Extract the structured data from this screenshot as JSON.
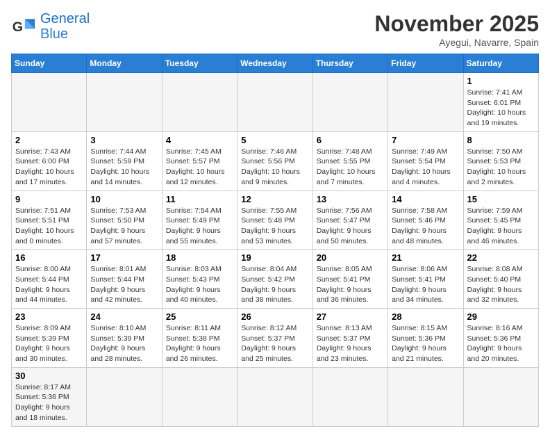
{
  "header": {
    "logo_general": "General",
    "logo_blue": "Blue",
    "month_title": "November 2025",
    "location": "Ayegui, Navarre, Spain"
  },
  "weekdays": [
    "Sunday",
    "Monday",
    "Tuesday",
    "Wednesday",
    "Thursday",
    "Friday",
    "Saturday"
  ],
  "weeks": [
    [
      {
        "day": "",
        "info": ""
      },
      {
        "day": "",
        "info": ""
      },
      {
        "day": "",
        "info": ""
      },
      {
        "day": "",
        "info": ""
      },
      {
        "day": "",
        "info": ""
      },
      {
        "day": "",
        "info": ""
      },
      {
        "day": "1",
        "info": "Sunrise: 7:41 AM\nSunset: 6:01 PM\nDaylight: 10 hours and 19 minutes."
      }
    ],
    [
      {
        "day": "2",
        "info": "Sunrise: 7:43 AM\nSunset: 6:00 PM\nDaylight: 10 hours and 17 minutes."
      },
      {
        "day": "3",
        "info": "Sunrise: 7:44 AM\nSunset: 5:59 PM\nDaylight: 10 hours and 14 minutes."
      },
      {
        "day": "4",
        "info": "Sunrise: 7:45 AM\nSunset: 5:57 PM\nDaylight: 10 hours and 12 minutes."
      },
      {
        "day": "5",
        "info": "Sunrise: 7:46 AM\nSunset: 5:56 PM\nDaylight: 10 hours and 9 minutes."
      },
      {
        "day": "6",
        "info": "Sunrise: 7:48 AM\nSunset: 5:55 PM\nDaylight: 10 hours and 7 minutes."
      },
      {
        "day": "7",
        "info": "Sunrise: 7:49 AM\nSunset: 5:54 PM\nDaylight: 10 hours and 4 minutes."
      },
      {
        "day": "8",
        "info": "Sunrise: 7:50 AM\nSunset: 5:53 PM\nDaylight: 10 hours and 2 minutes."
      }
    ],
    [
      {
        "day": "9",
        "info": "Sunrise: 7:51 AM\nSunset: 5:51 PM\nDaylight: 10 hours and 0 minutes."
      },
      {
        "day": "10",
        "info": "Sunrise: 7:53 AM\nSunset: 5:50 PM\nDaylight: 9 hours and 57 minutes."
      },
      {
        "day": "11",
        "info": "Sunrise: 7:54 AM\nSunset: 5:49 PM\nDaylight: 9 hours and 55 minutes."
      },
      {
        "day": "12",
        "info": "Sunrise: 7:55 AM\nSunset: 5:48 PM\nDaylight: 9 hours and 53 minutes."
      },
      {
        "day": "13",
        "info": "Sunrise: 7:56 AM\nSunset: 5:47 PM\nDaylight: 9 hours and 50 minutes."
      },
      {
        "day": "14",
        "info": "Sunrise: 7:58 AM\nSunset: 5:46 PM\nDaylight: 9 hours and 48 minutes."
      },
      {
        "day": "15",
        "info": "Sunrise: 7:59 AM\nSunset: 5:45 PM\nDaylight: 9 hours and 46 minutes."
      }
    ],
    [
      {
        "day": "16",
        "info": "Sunrise: 8:00 AM\nSunset: 5:44 PM\nDaylight: 9 hours and 44 minutes."
      },
      {
        "day": "17",
        "info": "Sunrise: 8:01 AM\nSunset: 5:44 PM\nDaylight: 9 hours and 42 minutes."
      },
      {
        "day": "18",
        "info": "Sunrise: 8:03 AM\nSunset: 5:43 PM\nDaylight: 9 hours and 40 minutes."
      },
      {
        "day": "19",
        "info": "Sunrise: 8:04 AM\nSunset: 5:42 PM\nDaylight: 9 hours and 38 minutes."
      },
      {
        "day": "20",
        "info": "Sunrise: 8:05 AM\nSunset: 5:41 PM\nDaylight: 9 hours and 36 minutes."
      },
      {
        "day": "21",
        "info": "Sunrise: 8:06 AM\nSunset: 5:41 PM\nDaylight: 9 hours and 34 minutes."
      },
      {
        "day": "22",
        "info": "Sunrise: 8:08 AM\nSunset: 5:40 PM\nDaylight: 9 hours and 32 minutes."
      }
    ],
    [
      {
        "day": "23",
        "info": "Sunrise: 8:09 AM\nSunset: 5:39 PM\nDaylight: 9 hours and 30 minutes."
      },
      {
        "day": "24",
        "info": "Sunrise: 8:10 AM\nSunset: 5:39 PM\nDaylight: 9 hours and 28 minutes."
      },
      {
        "day": "25",
        "info": "Sunrise: 8:11 AM\nSunset: 5:38 PM\nDaylight: 9 hours and 26 minutes."
      },
      {
        "day": "26",
        "info": "Sunrise: 8:12 AM\nSunset: 5:37 PM\nDaylight: 9 hours and 25 minutes."
      },
      {
        "day": "27",
        "info": "Sunrise: 8:13 AM\nSunset: 5:37 PM\nDaylight: 9 hours and 23 minutes."
      },
      {
        "day": "28",
        "info": "Sunrise: 8:15 AM\nSunset: 5:36 PM\nDaylight: 9 hours and 21 minutes."
      },
      {
        "day": "29",
        "info": "Sunrise: 8:16 AM\nSunset: 5:36 PM\nDaylight: 9 hours and 20 minutes."
      }
    ],
    [
      {
        "day": "30",
        "info": "Sunrise: 8:17 AM\nSunset: 5:36 PM\nDaylight: 9 hours and 18 minutes."
      },
      {
        "day": "",
        "info": ""
      },
      {
        "day": "",
        "info": ""
      },
      {
        "day": "",
        "info": ""
      },
      {
        "day": "",
        "info": ""
      },
      {
        "day": "",
        "info": ""
      },
      {
        "day": "",
        "info": ""
      }
    ]
  ]
}
